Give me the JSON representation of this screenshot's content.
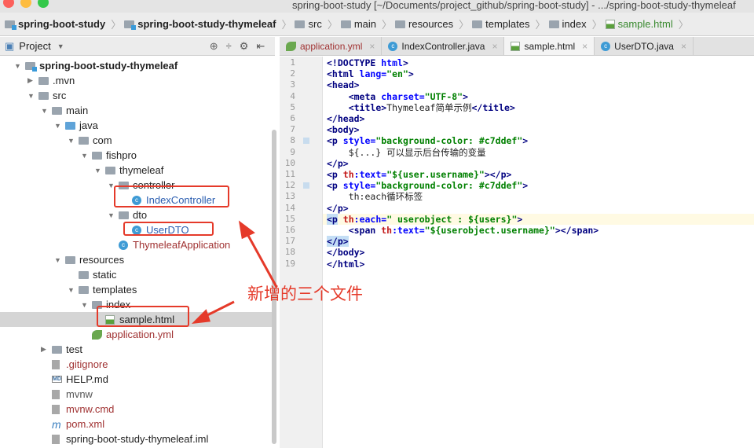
{
  "window": {
    "title": "spring-boot-study [~/Documents/project_github/spring-boot-study] - .../spring-boot-study-thymeleaf"
  },
  "breadcrumbs": [
    "spring-boot-study",
    "spring-boot-study-thymeleaf",
    "src",
    "main",
    "resources",
    "templates",
    "index",
    "sample.html"
  ],
  "project_panel": {
    "title": "Project"
  },
  "tree": [
    {
      "label": "spring-boot-study-thymeleaf",
      "level": 0,
      "arrow": "down",
      "icon": "module-folder",
      "bold": true
    },
    {
      "label": ".mvn",
      "level": 1,
      "arrow": "right",
      "icon": "folder"
    },
    {
      "label": "src",
      "level": 1,
      "arrow": "down",
      "icon": "folder"
    },
    {
      "label": "main",
      "level": 2,
      "arrow": "down",
      "icon": "folder"
    },
    {
      "label": "java",
      "level": 3,
      "arrow": "down",
      "icon": "source-folder"
    },
    {
      "label": "com",
      "level": 4,
      "arrow": "down",
      "icon": "package"
    },
    {
      "label": "fishpro",
      "level": 5,
      "arrow": "down",
      "icon": "package"
    },
    {
      "label": "thymeleaf",
      "level": 6,
      "arrow": "down",
      "icon": "package"
    },
    {
      "label": "controller",
      "level": 7,
      "arrow": "down",
      "icon": "package"
    },
    {
      "label": "IndexController",
      "level": 8,
      "icon": "class",
      "color": "#2a5db0",
      "boxed": true
    },
    {
      "label": "dto",
      "level": 7,
      "arrow": "down",
      "icon": "package"
    },
    {
      "label": "UserDTO",
      "level": 8,
      "icon": "class",
      "color": "#2a5db0",
      "boxed": true
    },
    {
      "label": "ThymeleafApplication",
      "level": 7,
      "icon": "spring-class",
      "color": "#a03232"
    },
    {
      "label": "resources",
      "level": 3,
      "arrow": "down",
      "icon": "resources-folder"
    },
    {
      "label": "static",
      "level": 4,
      "icon": "folder"
    },
    {
      "label": "templates",
      "level": 4,
      "arrow": "down",
      "icon": "folder"
    },
    {
      "label": "index",
      "level": 5,
      "arrow": "down",
      "icon": "folder"
    },
    {
      "label": "sample.html",
      "level": 6,
      "icon": "html-file",
      "selected": true,
      "boxed": true
    },
    {
      "label": "application.yml",
      "level": 5,
      "icon": "yml-file",
      "color": "#a03232"
    },
    {
      "label": "test",
      "level": 2,
      "arrow": "right",
      "icon": "folder"
    },
    {
      "label": ".gitignore",
      "level": 2,
      "icon": "text-file",
      "color": "#a03232"
    },
    {
      "label": "HELP.md",
      "level": 2,
      "icon": "markdown-file"
    },
    {
      "label": "mvnw",
      "level": 2,
      "icon": "text-file",
      "color": "#555555"
    },
    {
      "label": "mvnw.cmd",
      "level": 2,
      "icon": "text-file",
      "color": "#a03232"
    },
    {
      "label": "pom.xml",
      "level": 2,
      "icon": "maven-file",
      "color": "#a03232"
    },
    {
      "label": "spring-boot-study-thymeleaf.iml",
      "level": 2,
      "icon": "iml-file"
    }
  ],
  "tabs": [
    {
      "label": "application.yml",
      "icon": "yml-file",
      "color": "#a03232"
    },
    {
      "label": "IndexController.java",
      "icon": "class"
    },
    {
      "label": "sample.html",
      "icon": "html-file",
      "active": true
    },
    {
      "label": "UserDTO.java",
      "icon": "class"
    }
  ],
  "code": [
    [
      [
        "tag",
        "<!DOCTYPE "
      ],
      [
        "attr",
        "html"
      ],
      [
        "tag",
        ">"
      ]
    ],
    [
      [
        "tag",
        "<html "
      ],
      [
        "attr",
        "lang="
      ],
      [
        "val",
        "\"en\""
      ],
      [
        "tag",
        ">"
      ]
    ],
    [
      [
        "tag",
        "<head>"
      ]
    ],
    [
      [
        "txt",
        "    "
      ],
      [
        "tag",
        "<meta "
      ],
      [
        "attr",
        "charset="
      ],
      [
        "val",
        "\"UTF-8\""
      ],
      [
        "tag",
        ">"
      ]
    ],
    [
      [
        "txt",
        "    "
      ],
      [
        "tag",
        "<title>"
      ],
      [
        "txt",
        "Thymeleaf简单示例"
      ],
      [
        "tag",
        "</title>"
      ]
    ],
    [
      [
        "tag",
        "</head>"
      ]
    ],
    [
      [
        "tag",
        "<body>"
      ]
    ],
    [
      [
        "tag",
        "<p "
      ],
      [
        "attr",
        "style="
      ],
      [
        "val",
        "\"background-color: #c7ddef\""
      ],
      [
        "tag",
        ">"
      ]
    ],
    [
      [
        "txt",
        "    ${...} 可以显示后台传输的变量"
      ]
    ],
    [
      [
        "tag",
        "</p>"
      ]
    ],
    [
      [
        "tag",
        "<p "
      ],
      [
        "th",
        "th"
      ],
      [
        "attr",
        ":text="
      ],
      [
        "val",
        "\"${user.username}\""
      ],
      [
        "tag",
        "></p>"
      ]
    ],
    [
      [
        "tag",
        "<p "
      ],
      [
        "attr",
        "style="
      ],
      [
        "val",
        "\"background-color: #c7ddef\""
      ],
      [
        "tag",
        ">"
      ]
    ],
    [
      [
        "txt",
        "    th:each循环标签"
      ]
    ],
    [
      [
        "tag",
        "</p>"
      ]
    ],
    [
      [
        "tag hl",
        "<p"
      ],
      [
        "tag",
        " "
      ],
      [
        "th",
        "th"
      ],
      [
        "attr",
        ":each="
      ],
      [
        "val",
        "\" userobject : ${users}\""
      ],
      [
        "tag",
        ">"
      ]
    ],
    [
      [
        "txt",
        "    "
      ],
      [
        "tag",
        "<span "
      ],
      [
        "th",
        "th"
      ],
      [
        "attr",
        ":text="
      ],
      [
        "val",
        "\"${userobject.username}\""
      ],
      [
        "tag",
        "></span>"
      ]
    ],
    [
      [
        "tag hl",
        "</p>"
      ]
    ],
    [
      [
        "tag",
        "</body>"
      ]
    ],
    [
      [
        "tag",
        "</html>"
      ]
    ]
  ],
  "current_line": 15,
  "bookmarked_lines": [
    8,
    12
  ],
  "annotation": {
    "text": "新增的三个文件",
    "color": "#e53a2a"
  }
}
